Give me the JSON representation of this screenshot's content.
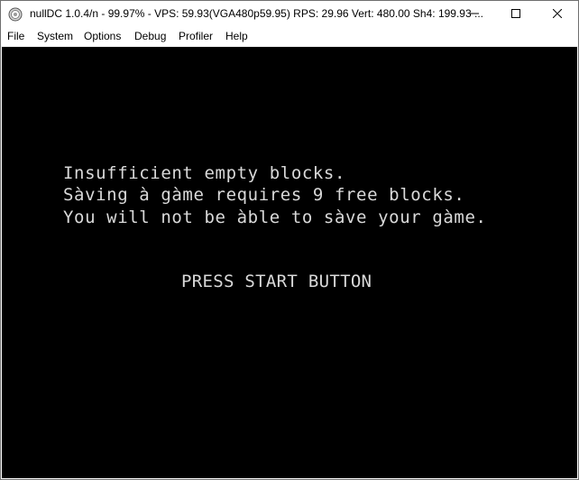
{
  "window": {
    "title": "nullDC 1.0.4/n - 99.97% - VPS: 59.93(VGA480p59.95) RPS: 29.96 Vert: 480.00 Sh4: 199.93 ...",
    "icon": "nulldc-app-icon",
    "controls": {
      "minimize_icon": "minimize-icon",
      "maximize_icon": "maximize-icon",
      "close_icon": "close-icon"
    }
  },
  "menu": {
    "items": [
      "File",
      "System",
      "Options",
      "Debug",
      "Profiler",
      "Help"
    ]
  },
  "game_screen": {
    "message_lines": [
      "Insufficient empty blocks.",
      "Sàving à gàme requires 9 free blocks.",
      "You will not be àble to sàve your gàme."
    ],
    "prompt": "PRESS START BUTTON",
    "background_color": "#000000",
    "text_color": "#d9d9d9"
  }
}
